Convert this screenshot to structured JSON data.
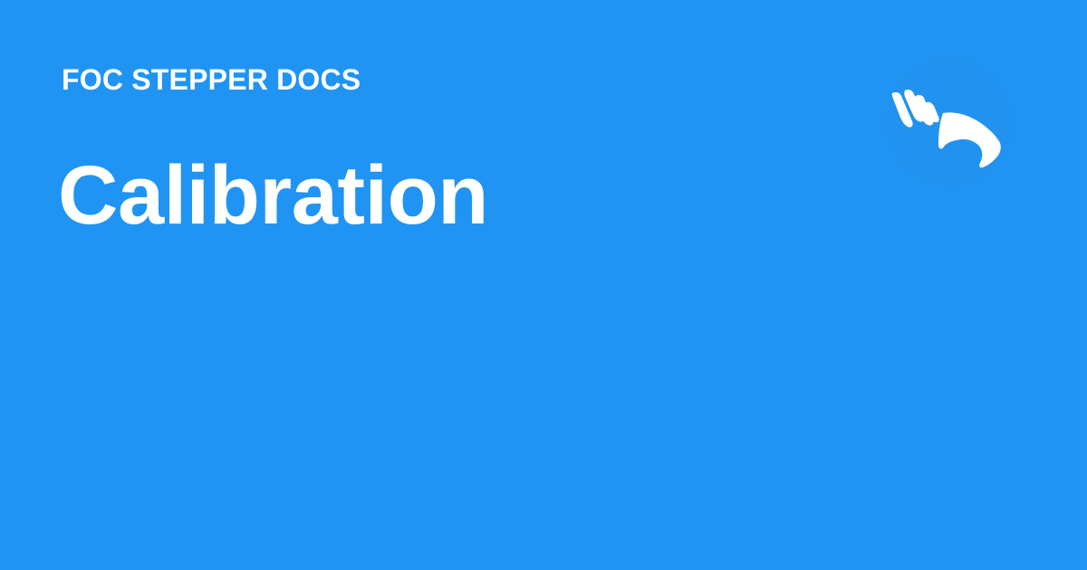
{
  "header": {
    "site_name": "FOC STEPPER DOCS"
  },
  "main": {
    "title": "Calibration"
  },
  "logo": {
    "icon": "hand-icon"
  },
  "colors": {
    "background": "#2094f3",
    "foreground": "#ffffff"
  }
}
